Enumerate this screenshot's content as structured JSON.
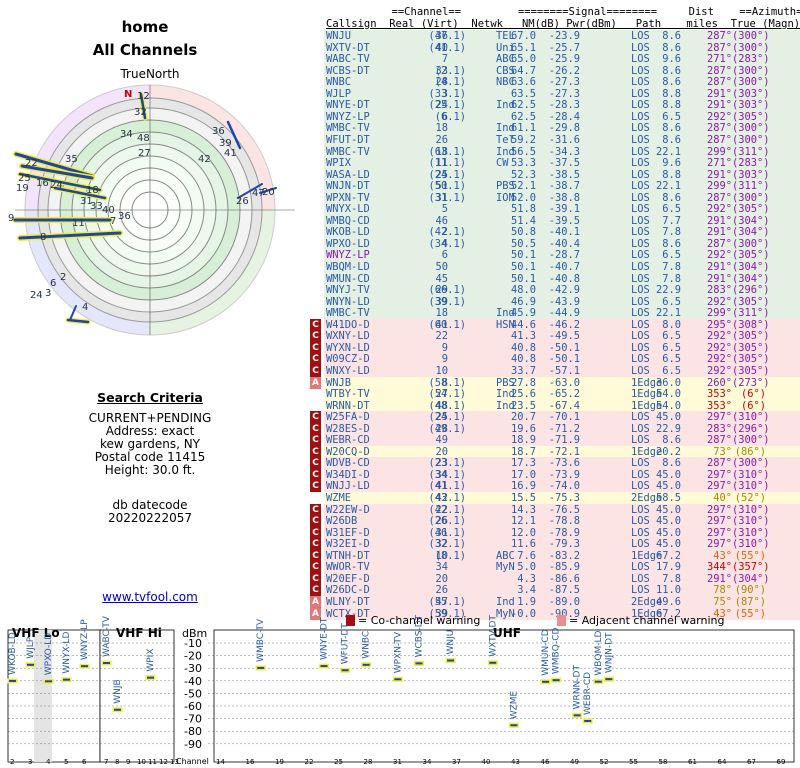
{
  "header": {
    "location": "home",
    "subtitle": "All Channels",
    "north_label": "TrueNorth"
  },
  "search": {
    "title": "Search Criteria",
    "lines": [
      "CURRENT+PENDING",
      "Address: exact",
      "kew gardens, NY",
      "Postal code 11415",
      "Height: 30.0 ft."
    ],
    "datecode_label": "db datecode",
    "datecode": "20220222057",
    "link": "www.tvfool.com"
  },
  "table": {
    "header1": "           ==Channel==         ========Signal========     Dist    ==Azimuth==",
    "header2": "Callsign  Real (Virt)  Netwk   NM(dB) Pwr(dBm)   Path    miles  True (Magn)",
    "rows": [
      {
        "call": "WNJU",
        "real": "36",
        "virt": "(47.1)",
        "net": "TEL",
        "nm": "67.0",
        "pwr": "-23.9",
        "path": "LOS",
        "dist": "8.6",
        "az": "287°",
        "mag": "(300°)",
        "band": "green",
        "flag": ""
      },
      {
        "call": "WXTV-DT",
        "real": "40",
        "virt": "(41.1)",
        "net": "Uni",
        "nm": "65.1",
        "pwr": "-25.7",
        "path": "LOS",
        "dist": "8.6",
        "az": "287°",
        "mag": "(300°)",
        "band": "green",
        "flag": ""
      },
      {
        "call": "WABC-TV",
        "real": "7",
        "virt": "",
        "net": "ABC",
        "nm": "65.0",
        "pwr": "-25.9",
        "path": "LOS",
        "dist": "9.6",
        "az": "271°",
        "mag": "(283°)",
        "band": "green",
        "flag": ""
      },
      {
        "call": "WCBS-DT",
        "real": "33",
        "virt": "(2.1)",
        "net": "CBS",
        "nm": "64.7",
        "pwr": "-26.2",
        "path": "LOS",
        "dist": "8.6",
        "az": "287°",
        "mag": "(300°)",
        "band": "green",
        "flag": ""
      },
      {
        "call": "WNBC",
        "real": "28",
        "virt": "(4.1)",
        "net": "NBC",
        "nm": "63.6",
        "pwr": "-27.3",
        "path": "LOS",
        "dist": "8.6",
        "az": "287°",
        "mag": "(300°)",
        "band": "green",
        "flag": ""
      },
      {
        "call": "WJLP",
        "real": "3",
        "virt": "(33.1)",
        "net": "",
        "nm": "63.5",
        "pwr": "-27.3",
        "path": "LOS",
        "dist": "8.8",
        "az": "291°",
        "mag": "(303°)",
        "band": "green",
        "flag": ""
      },
      {
        "call": "WNYE-DT",
        "real": "24",
        "virt": "(25.1)",
        "net": "Ind",
        "nm": "62.5",
        "pwr": "-28.3",
        "path": "LOS",
        "dist": "8.8",
        "az": "291°",
        "mag": "(303°)",
        "band": "green",
        "flag": ""
      },
      {
        "call": "WNYZ-LP",
        "real": "6",
        "virt": "(6.1)",
        "net": "",
        "nm": "62.5",
        "pwr": "-28.4",
        "path": "LOS",
        "dist": "6.5",
        "az": "292°",
        "mag": "(305°)",
        "band": "green",
        "flag": ""
      },
      {
        "call": "WMBC-TV",
        "real": "18",
        "virt": "",
        "net": "Ind",
        "nm": "61.1",
        "pwr": "-29.8",
        "path": "LOS",
        "dist": "8.6",
        "az": "287°",
        "mag": "(300°)",
        "band": "green",
        "flag": ""
      },
      {
        "call": "WFUT-DT",
        "real": "26",
        "virt": "",
        "net": "Tel",
        "nm": "59.2",
        "pwr": "-31.6",
        "path": "LOS",
        "dist": "8.6",
        "az": "287°",
        "mag": "(300°)",
        "band": "green",
        "flag": ""
      },
      {
        "call": "WMBC-TV",
        "real": "18",
        "virt": "(63.1)",
        "net": "Ind",
        "nm": "56.5",
        "pwr": "-34.3",
        "path": "LOS",
        "dist": "22.1",
        "az": "299°",
        "mag": "(311°)",
        "band": "green",
        "flag": ""
      },
      {
        "call": "WPIX",
        "real": "11",
        "virt": "(11.1)",
        "net": "CW",
        "nm": "53.3",
        "pwr": "-37.5",
        "path": "LOS",
        "dist": "9.6",
        "az": "271°",
        "mag": "(283°)",
        "band": "green",
        "flag": ""
      },
      {
        "call": "WASA-LD",
        "real": "25",
        "virt": "(24.1)",
        "net": "",
        "nm": "52.3",
        "pwr": "-38.5",
        "path": "LOS",
        "dist": "8.8",
        "az": "291°",
        "mag": "(303°)",
        "band": "green",
        "flag": ""
      },
      {
        "call": "WNJN-DT",
        "real": "51",
        "virt": "(50.1)",
        "net": "PBS",
        "nm": "52.1",
        "pwr": "-38.7",
        "path": "LOS",
        "dist": "22.1",
        "az": "299°",
        "mag": "(311°)",
        "band": "green",
        "flag": ""
      },
      {
        "call": "WPXN-TV",
        "real": "31",
        "virt": "(31.1)",
        "net": "ION",
        "nm": "52.0",
        "pwr": "-38.8",
        "path": "LOS",
        "dist": "8.6",
        "az": "287°",
        "mag": "(300°)",
        "band": "green",
        "flag": ""
      },
      {
        "call": "WNYX-LD",
        "real": "5",
        "virt": "",
        "net": "",
        "nm": "51.8",
        "pwr": "-39.1",
        "path": "LOS",
        "dist": "6.5",
        "az": "292°",
        "mag": "(305°)",
        "band": "green",
        "flag": ""
      },
      {
        "call": "WMBQ-CD",
        "real": "46",
        "virt": "",
        "net": "",
        "nm": "51.4",
        "pwr": "-39.5",
        "path": "LOS",
        "dist": "7.7",
        "az": "291°",
        "mag": "(304°)",
        "band": "green",
        "flag": ""
      },
      {
        "call": "WKOB-LD",
        "real": "2",
        "virt": "(42.1)",
        "net": "",
        "nm": "50.8",
        "pwr": "-40.1",
        "path": "LOS",
        "dist": "7.8",
        "az": "291°",
        "mag": "(304°)",
        "band": "green",
        "flag": ""
      },
      {
        "call": "WPXO-LD",
        "real": "4",
        "virt": "(34.1)",
        "net": "",
        "nm": "50.5",
        "pwr": "-40.4",
        "path": "LOS",
        "dist": "8.6",
        "az": "287°",
        "mag": "(300°)",
        "band": "green",
        "flag": ""
      },
      {
        "call": "WNYZ-LP",
        "real": "6",
        "virt": "",
        "net": "",
        "nm": "50.1",
        "pwr": "-28.7",
        "path": "LOS",
        "dist": "6.5",
        "az": "292°",
        "mag": "(305°)",
        "band": "green",
        "flag": "",
        "purple": true
      },
      {
        "call": "WBQM-LD",
        "real": "50",
        "virt": "",
        "net": "",
        "nm": "50.1",
        "pwr": "-40.7",
        "path": "LOS",
        "dist": "7.8",
        "az": "291°",
        "mag": "(304°)",
        "band": "green",
        "flag": ""
      },
      {
        "call": "WMUN-CD",
        "real": "45",
        "virt": "",
        "net": "",
        "nm": "50.1",
        "pwr": "-40.8",
        "path": "LOS",
        "dist": "7.8",
        "az": "291°",
        "mag": "(304°)",
        "band": "green",
        "flag": ""
      },
      {
        "call": "WNYJ-TV",
        "real": "29",
        "virt": "(66.1)",
        "net": "",
        "nm": "48.0",
        "pwr": "-42.9",
        "path": "LOS",
        "dist": "22.9",
        "az": "283°",
        "mag": "(296°)",
        "band": "green",
        "flag": ""
      },
      {
        "call": "WNYN-LD",
        "real": "39",
        "virt": "(39.1)",
        "net": "",
        "nm": "46.9",
        "pwr": "-43.9",
        "path": "LOS",
        "dist": "6.5",
        "az": "292°",
        "mag": "(305°)",
        "band": "green",
        "flag": ""
      },
      {
        "call": "WMBC-TV",
        "real": "18",
        "virt": "",
        "net": "Ind",
        "nm": "45.9",
        "pwr": "-44.9",
        "path": "LOS",
        "dist": "22.1",
        "az": "299°",
        "mag": "(311°)",
        "band": "green",
        "flag": ""
      },
      {
        "call": "W41DO-D",
        "real": "41",
        "virt": "(60.1)",
        "net": "HSN",
        "nm": "44.6",
        "pwr": "-46.2",
        "path": "LOS",
        "dist": "8.0",
        "az": "295°",
        "mag": "(308°)",
        "band": "pink",
        "flag": "C"
      },
      {
        "call": "WXNY-LD",
        "real": "22",
        "virt": "",
        "net": "",
        "nm": "41.3",
        "pwr": "-49.5",
        "path": "LOS",
        "dist": "6.5",
        "az": "292°",
        "mag": "(305°)",
        "band": "pink",
        "flag": "C"
      },
      {
        "call": "WYXN-LD",
        "real": "9",
        "virt": "",
        "net": "",
        "nm": "40.8",
        "pwr": "-50.1",
        "path": "LOS",
        "dist": "6.5",
        "az": "292°",
        "mag": "(305°)",
        "band": "pink",
        "flag": "C"
      },
      {
        "call": "W09CZ-D",
        "real": "9",
        "virt": "",
        "net": "",
        "nm": "40.8",
        "pwr": "-50.1",
        "path": "LOS",
        "dist": "6.5",
        "az": "292°",
        "mag": "(305°)",
        "band": "pink",
        "flag": "C"
      },
      {
        "call": "WNXY-LD",
        "real": "10",
        "virt": "",
        "net": "",
        "nm": "33.7",
        "pwr": "-57.1",
        "path": "LOS",
        "dist": "6.5",
        "az": "292°",
        "mag": "(305°)",
        "band": "pink",
        "flag": "C"
      },
      {
        "call": "WNJB",
        "real": "8",
        "virt": "(58.1)",
        "net": "PBS",
        "nm": "27.8",
        "pwr": "-63.0",
        "path": "1Edge",
        "dist": "36.0",
        "az": "260°",
        "mag": "(273°)",
        "band": "yellow",
        "flag": "A"
      },
      {
        "call": "WTBY-TV",
        "real": "27",
        "virt": "(54.1)",
        "net": "Ind",
        "nm": "25.6",
        "pwr": "-65.2",
        "path": "1Edge",
        "dist": "54.0",
        "az": "353°",
        "mag": "(6°)",
        "band": "yellow",
        "flag": "",
        "azcolor": "#c00"
      },
      {
        "call": "WRNN-DT",
        "real": "48",
        "virt": "(48.1)",
        "net": "Ind",
        "nm": "23.5",
        "pwr": "-67.4",
        "path": "1Edge",
        "dist": "54.0",
        "az": "353°",
        "mag": "(6°)",
        "band": "yellow",
        "flag": "",
        "azcolor": "#c00"
      },
      {
        "call": "W25FA-D",
        "real": "25",
        "virt": "(24.1)",
        "net": "",
        "nm": "20.7",
        "pwr": "-70.1",
        "path": "LOS",
        "dist": "45.0",
        "az": "297°",
        "mag": "(310°)",
        "band": "pink",
        "flag": "C"
      },
      {
        "call": "W28ES-D",
        "real": "28",
        "virt": "(49.1)",
        "net": "",
        "nm": "19.6",
        "pwr": "-71.2",
        "path": "LOS",
        "dist": "22.9",
        "az": "283°",
        "mag": "(296°)",
        "band": "pink",
        "flag": "C"
      },
      {
        "call": "WEBR-CD",
        "real": "49",
        "virt": "",
        "net": "",
        "nm": "18.9",
        "pwr": "-71.9",
        "path": "LOS",
        "dist": "8.6",
        "az": "287°",
        "mag": "(300°)",
        "band": "pink",
        "flag": "C"
      },
      {
        "call": "W20CQ-D",
        "real": "20",
        "virt": "",
        "net": "",
        "nm": "18.7",
        "pwr": "-72.1",
        "path": "1Edge",
        "dist": "20.2",
        "az": "73°",
        "mag": "(86°)",
        "band": "yellow",
        "flag": "C",
        "azcolor": "#a80"
      },
      {
        "call": "WDVB-CD",
        "real": "23",
        "virt": "(23.1)",
        "net": "",
        "nm": "17.3",
        "pwr": "-73.6",
        "path": "LOS",
        "dist": "8.6",
        "az": "287°",
        "mag": "(300°)",
        "band": "pink",
        "flag": "C"
      },
      {
        "call": "W34DI-D",
        "real": "34",
        "virt": "(34.1)",
        "net": "",
        "nm": "17.0",
        "pwr": "-73.9",
        "path": "LOS",
        "dist": "45.0",
        "az": "297°",
        "mag": "(310°)",
        "band": "pink",
        "flag": "C"
      },
      {
        "call": "WNJJ-LD",
        "real": "41",
        "virt": "(41.1)",
        "net": "",
        "nm": "16.9",
        "pwr": "-74.0",
        "path": "LOS",
        "dist": "45.0",
        "az": "297°",
        "mag": "(310°)",
        "band": "pink",
        "flag": "C"
      },
      {
        "call": "WZME",
        "real": "42",
        "virt": "(43.1)",
        "net": "",
        "nm": "15.5",
        "pwr": "-75.3",
        "path": "2Edge",
        "dist": "58.5",
        "az": "40°",
        "mag": "(52°)",
        "band": "yellow",
        "flag": "",
        "azcolor": "#a80"
      },
      {
        "call": "W22EW-D",
        "real": "22",
        "virt": "(42.1)",
        "net": "",
        "nm": "14.3",
        "pwr": "-76.5",
        "path": "LOS",
        "dist": "45.0",
        "az": "297°",
        "mag": "(310°)",
        "band": "pink",
        "flag": "C"
      },
      {
        "call": "W26DB",
        "real": "26",
        "virt": "(26.1)",
        "net": "",
        "nm": "12.1",
        "pwr": "-78.8",
        "path": "LOS",
        "dist": "45.0",
        "az": "297°",
        "mag": "(310°)",
        "band": "pink",
        "flag": "C"
      },
      {
        "call": "W31EF-D",
        "real": "31",
        "virt": "(46.1)",
        "net": "",
        "nm": "12.0",
        "pwr": "-78.9",
        "path": "LOS",
        "dist": "45.0",
        "az": "297°",
        "mag": "(310°)",
        "band": "pink",
        "flag": "C"
      },
      {
        "call": "W32EI-D",
        "real": "32",
        "virt": "(32.1)",
        "net": "",
        "nm": "11.6",
        "pwr": "-79.3",
        "path": "LOS",
        "dist": "45.0",
        "az": "297°",
        "mag": "(310°)",
        "band": "pink",
        "flag": "C"
      },
      {
        "call": "WTNH-DT",
        "real": "10",
        "virt": "(8.1)",
        "net": "ABC",
        "nm": "7.6",
        "pwr": "-83.2",
        "path": "1Edge",
        "dist": "67.2",
        "az": "43°",
        "mag": "(55°)",
        "band": "pink",
        "flag": "C",
        "azcolor": "#d60"
      },
      {
        "call": "WWOR-TV",
        "real": "34",
        "virt": "",
        "net": "MyN",
        "nm": "5.0",
        "pwr": "-85.9",
        "path": "LOS",
        "dist": "17.9",
        "az": "344°",
        "mag": "(357°)",
        "band": "pink",
        "flag": "C",
        "azcolor": "#c00"
      },
      {
        "call": "W20EF-D",
        "real": "20",
        "virt": "",
        "net": "",
        "nm": "4.3",
        "pwr": "-86.6",
        "path": "LOS",
        "dist": "7.8",
        "az": "291°",
        "mag": "(304°)",
        "band": "pink",
        "flag": "C"
      },
      {
        "call": "W26DC-D",
        "real": "26",
        "virt": "",
        "net": "",
        "nm": "3.4",
        "pwr": "-87.5",
        "path": "LOS",
        "dist": "11.0",
        "az": "78°",
        "mag": "(90°)",
        "band": "pink",
        "flag": "C",
        "azcolor": "#a80"
      },
      {
        "call": "WLNY-DT",
        "real": "47",
        "virt": "(55.1)",
        "net": "Ind",
        "nm": "1.9",
        "pwr": "-89.0",
        "path": "2Edge",
        "dist": "49.6",
        "az": "75°",
        "mag": "(87°)",
        "band": "pink",
        "flag": "A",
        "azcolor": "#a80"
      },
      {
        "call": "WCTX-DT",
        "real": "39",
        "virt": "(59.1)",
        "net": "MyN",
        "nm": "-0.0",
        "pwr": "-90.9",
        "path": "1Edge",
        "dist": "67.2",
        "az": "43°",
        "mag": "(55°)",
        "band": "pink",
        "flag": "A",
        "azcolor": "#d60"
      }
    ]
  },
  "legend": {
    "co_channel": "= Co-channel warning",
    "adjacent": "= Adjacent channel warning",
    "co_flag": "C",
    "adj_flag": "A"
  },
  "spectrum": {
    "vhf_lo": "VHF Lo",
    "vhf_hi": "VHF Hi",
    "uhf": "UHF",
    "dbm": "dBm",
    "channel_label": "Channel",
    "dbm_ticks": [
      "-10",
      "-20",
      "-30",
      "-40",
      "-50",
      "-60",
      "-70",
      "-80",
      "-90"
    ],
    "lo_ticks": [
      "2",
      "3",
      "4",
      "5",
      "6"
    ],
    "hi_ticks": [
      "7",
      "8",
      "9",
      "10",
      "11",
      "12",
      "13"
    ],
    "uhf_ticks": [
      "14",
      "16",
      "19",
      "22",
      "25",
      "28",
      "31",
      "34",
      "37",
      "40",
      "43",
      "46",
      "49",
      "52",
      "55",
      "58",
      "61",
      "64",
      "67",
      "69"
    ],
    "markers": [
      {
        "ch": "2",
        "label": "WKOB-LD",
        "dbm": -40.1
      },
      {
        "ch": "3",
        "label": "WJLP",
        "dbm": -27.3
      },
      {
        "ch": "4",
        "label": "WPXO-LD",
        "dbm": -40.4
      },
      {
        "ch": "5",
        "label": "WNYX-LD",
        "dbm": -39.1
      },
      {
        "ch": "6",
        "label": "WNYZ-LP",
        "dbm": -28.4
      },
      {
        "ch": "7",
        "label": "WABC-TV",
        "dbm": -25.9
      },
      {
        "ch": "8",
        "label": "WNJB",
        "dbm": -63.0
      },
      {
        "ch": "11",
        "label": "WPIX",
        "dbm": -37.5
      },
      {
        "ch": "18",
        "label": "WMBC-TV",
        "dbm": -29.8
      },
      {
        "ch": "24",
        "label": "WNYE-DT",
        "dbm": -28.3
      },
      {
        "ch": "26",
        "label": "WFUT-DT",
        "dbm": -31.6
      },
      {
        "ch": "28",
        "label": "WNBC",
        "dbm": -27.3
      },
      {
        "ch": "31",
        "label": "WPXN-TV",
        "dbm": -38.8
      },
      {
        "ch": "33",
        "label": "WCBS-DT",
        "dbm": -26.2
      },
      {
        "ch": "36",
        "label": "WNJU",
        "dbm": -23.9
      },
      {
        "ch": "40",
        "label": "WXTV-DT",
        "dbm": -25.7
      },
      {
        "ch": "45",
        "label": "WMUN-CD",
        "dbm": -40.8
      },
      {
        "ch": "46",
        "label": "WMBQ-CD",
        "dbm": -39.5
      },
      {
        "ch": "50",
        "label": "WBQM-LD",
        "dbm": -40.7
      },
      {
        "ch": "51",
        "label": "WNJN-DT",
        "dbm": -38.7
      },
      {
        "ch": "48",
        "label": "WRNN-DT",
        "dbm": -67.4
      },
      {
        "ch": "49",
        "label": "WEBR-CD",
        "dbm": -71.9
      },
      {
        "ch": "42",
        "label": "WZME",
        "dbm": -75.3
      }
    ]
  },
  "polar": {
    "north": "N",
    "labels": [
      "12",
      "32",
      "34",
      "48",
      "27",
      "36",
      "39",
      "41",
      "42",
      "35",
      "26",
      "47",
      "20",
      "22",
      "25",
      "19",
      "16",
      "24",
      "18",
      "31",
      "33",
      "40",
      "36",
      "11",
      "7",
      "9",
      "8",
      "6",
      "2",
      "24",
      "3",
      "4"
    ]
  }
}
